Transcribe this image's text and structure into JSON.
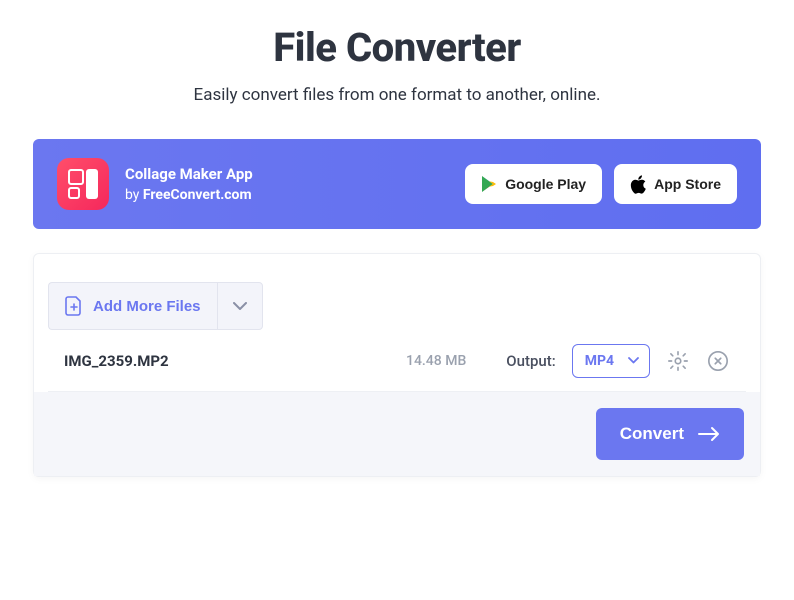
{
  "header": {
    "title": "File Converter",
    "subtitle": "Easily convert files from one format to another, online."
  },
  "banner": {
    "app_name": "Collage Maker App",
    "by_prefix": "by ",
    "brand": "FreeConvert.com",
    "google_play_label": "Google Play",
    "app_store_label": "App Store"
  },
  "add": {
    "label": "Add More Files"
  },
  "file": {
    "name": "IMG_2359.MP2",
    "size": "14.48 MB",
    "output_label": "Output:",
    "format": "MP4"
  },
  "actions": {
    "convert_label": "Convert"
  }
}
